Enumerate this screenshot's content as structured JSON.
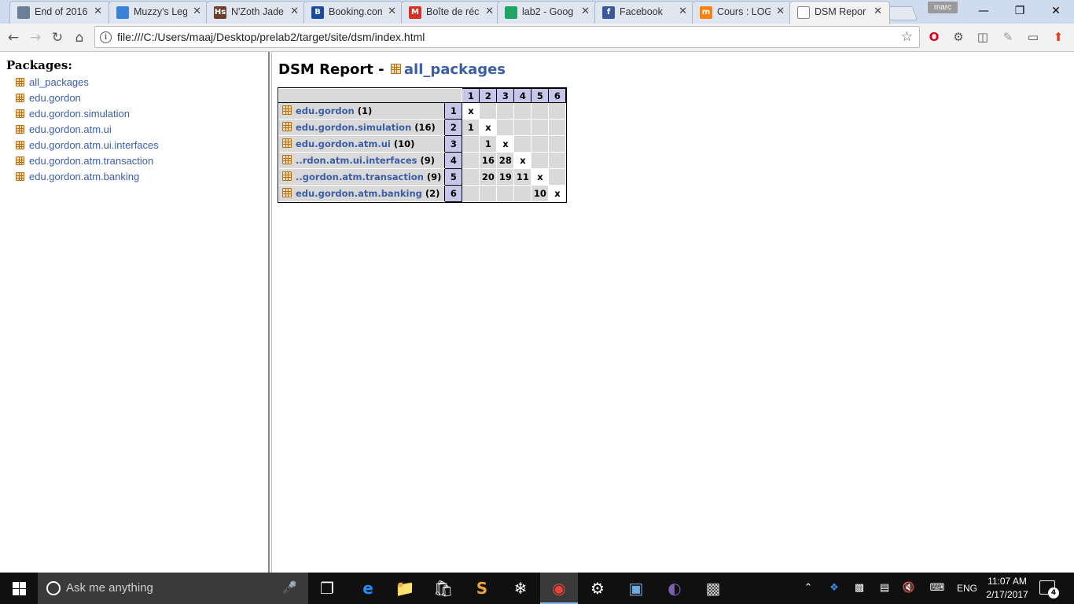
{
  "browser": {
    "tabs": [
      {
        "title": "End of 2016",
        "icon": "end-of-2016-favicon-icon",
        "color": "#6b7f99"
      },
      {
        "title": "Muzzy's Leg",
        "icon": "muzzys-favicon-icon",
        "color": "#3a82d8"
      },
      {
        "title": "N'Zoth Jade",
        "icon": "hs-favicon-icon",
        "color": "#6b3d2e",
        "glyph": "Hs"
      },
      {
        "title": "Booking.com",
        "icon": "booking-favicon-icon",
        "color": "#1b4b9b",
        "glyph": "B"
      },
      {
        "title": "Boîte de réc",
        "icon": "gmail-favicon-icon",
        "color": "#d93025",
        "glyph": "M"
      },
      {
        "title": "lab2 - Goog",
        "icon": "google-drive-favicon-icon",
        "color": "#1fa463"
      },
      {
        "title": "Facebook",
        "icon": "facebook-favicon-icon",
        "color": "#3b5998",
        "glyph": "f"
      },
      {
        "title": "Cours : LOG",
        "icon": "moodle-favicon-icon",
        "color": "#f98012",
        "glyph": "m"
      },
      {
        "title": "DSM Repor",
        "icon": "page-favicon-icon",
        "color": "#ffffff",
        "active": true
      }
    ],
    "close_glyph": "✕",
    "user_badge": "marc",
    "window_controls": {
      "minimize": "—",
      "restore": "❐",
      "close": "✕"
    },
    "url": "file:///C:/Users/maaj/Desktop/prelab2/target/site/dsm/index.html"
  },
  "left_frame": {
    "heading": "Packages:",
    "packages": [
      "all_packages",
      "edu.gordon",
      "edu.gordon.simulation",
      "edu.gordon.atm.ui",
      "edu.gordon.atm.ui.interfaces",
      "edu.gordon.atm.transaction",
      "edu.gordon.atm.banking"
    ]
  },
  "report": {
    "title_prefix": "DSM Report -",
    "title_link": "all_packages",
    "column_headers": [
      "1",
      "2",
      "3",
      "4",
      "5",
      "6"
    ],
    "rows": [
      {
        "name": "edu.gordon",
        "count": "(1)",
        "num": "1",
        "cells": [
          "x",
          "",
          "",
          "",
          "",
          ""
        ]
      },
      {
        "name": "edu.gordon.simulation",
        "count": "(16)",
        "num": "2",
        "cells": [
          "1",
          "x",
          "",
          "",
          "",
          ""
        ]
      },
      {
        "name": "edu.gordon.atm.ui",
        "count": "(10)",
        "num": "3",
        "cells": [
          "",
          "1",
          "x",
          "",
          "",
          ""
        ]
      },
      {
        "name": "..rdon.atm.ui.interfaces",
        "count": "(9)",
        "num": "4",
        "cells": [
          "",
          "16",
          "28",
          "x",
          "",
          ""
        ]
      },
      {
        "name": "..gordon.atm.transaction",
        "count": "(9)",
        "num": "5",
        "cells": [
          "",
          "20",
          "19",
          "11",
          "x",
          ""
        ]
      },
      {
        "name": "edu.gordon.atm.banking",
        "count": "(2)",
        "num": "6",
        "cells": [
          "",
          "",
          "",
          "",
          "10",
          "x"
        ]
      }
    ]
  },
  "taskbar": {
    "search_placeholder": "Ask me anything",
    "language": "ENG",
    "time": "11:07 AM",
    "date": "2/17/2017",
    "notification_count": "4"
  }
}
